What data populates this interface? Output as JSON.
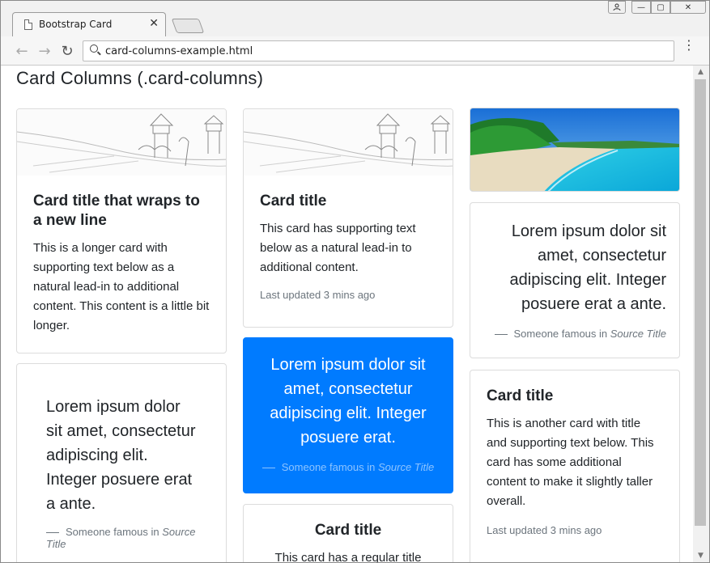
{
  "browser": {
    "tab_title": "Bootstrap Card",
    "tab_close": "✕",
    "address": "card-columns-example.html",
    "back": "←",
    "forward": "→",
    "reload": "↻",
    "menu": "⋮",
    "user_icon": "person-icon",
    "min_label": "—",
    "max_label": "▢",
    "close_label": "✕"
  },
  "page": {
    "title": "Card Columns (.card-columns)"
  },
  "cards": {
    "c1": {
      "title": "Card title that wraps to a new line",
      "text": "This is a longer card with supporting text below as a natural lead-in to additional content. This content is a little bit longer."
    },
    "c2": {
      "quote": "Lorem ipsum dolor sit amet, consectetur adipiscing elit. Integer posuere erat a ante.",
      "footer_prefix": "Someone famous in ",
      "footer_source": "Source Title"
    },
    "c3": {
      "title": "Card title",
      "text": "This card has supporting text below as a natural lead-in to additional content.",
      "updated": "Last updated 3 mins ago"
    },
    "c4": {
      "quote": "Lorem ipsum dolor sit amet, consectetur adipiscing elit. Integer posuere erat.",
      "footer_prefix": "Someone famous in ",
      "footer_source": "Source Title"
    },
    "c5": {
      "title": "Card title",
      "text": "This card has a regular title"
    },
    "c6": {
      "quote": "Lorem ipsum dolor sit amet, consectetur adipiscing elit. Integer posuere erat a ante.",
      "footer_prefix": "Someone famous in ",
      "footer_source": "Source Title"
    },
    "c7": {
      "title": "Card title",
      "text": "This is another card with title and supporting text below. This card has some additional content to make it slightly taller overall.",
      "updated": "Last updated 3 mins ago"
    }
  },
  "colors": {
    "primary": "#007bff",
    "text": "#212529",
    "muted": "#6c757d"
  }
}
